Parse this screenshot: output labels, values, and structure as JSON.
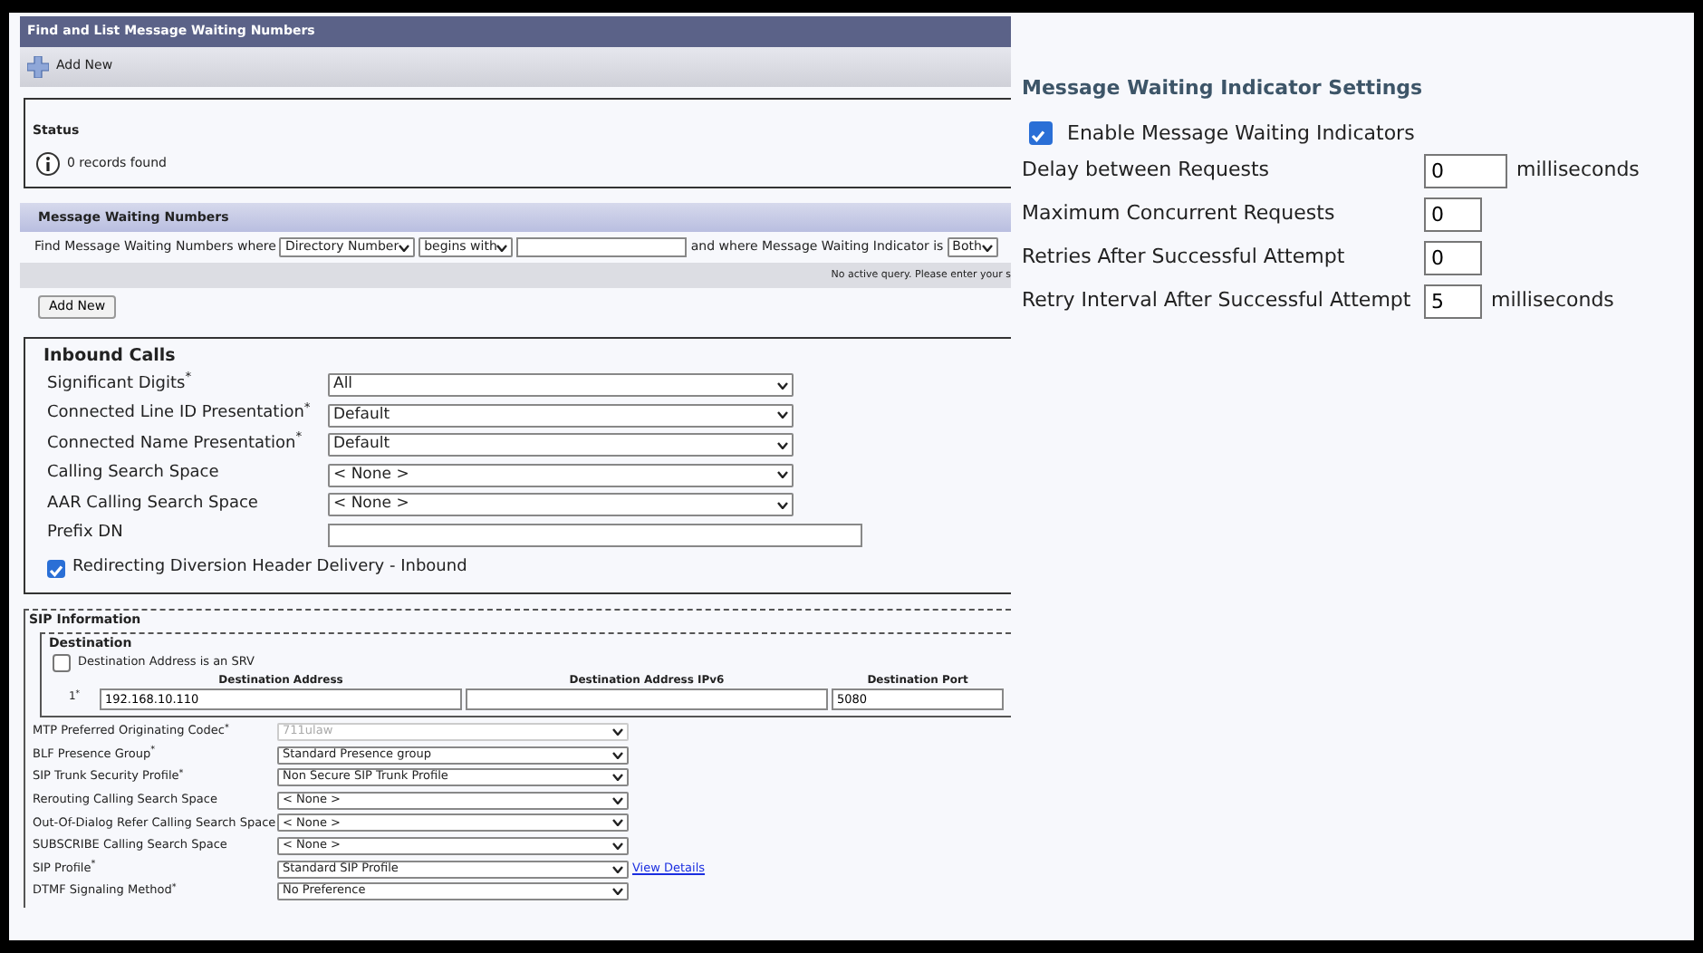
{
  "find_panel": {
    "title": "Find and List Message Waiting Numbers",
    "toolbar_button": "Add New",
    "status": {
      "legend": "Status",
      "message": "0 records found"
    },
    "section_title": "Message Waiting Numbers",
    "search": [
      {
        "kind": "label",
        "text": "Find Message Waiting Numbers where"
      },
      {
        "kind": "select",
        "value": "Directory Number"
      },
      {
        "kind": "select",
        "value": "begins with"
      },
      {
        "kind": "input"
      },
      {
        "kind": "label",
        "text": "and where Message Waiting Indicator is"
      },
      {
        "kind": "select",
        "value": "Both"
      }
    ],
    "notice": "No active query. Please enter your s",
    "button": "Add New"
  },
  "inbound_calls": {
    "legend": "Inbound Calls",
    "fields": [
      {
        "kind": "select",
        "label": "Significant Digits$^{*}$",
        "value": "All"
      },
      {
        "kind": "select",
        "label": "Connected Line ID Presentation$^{*}$",
        "value": "Default"
      },
      {
        "kind": "select",
        "label": "Connected Name Presentation$^{*}$",
        "value": "Default"
      },
      {
        "kind": "select",
        "label": "Calling Search Space",
        "value": "< None >"
      },
      {
        "kind": "select",
        "label": "AAR Calling Search Space",
        "value": "< None >"
      },
      {
        "kind": "input",
        "label": "Prefix DN"
      }
    ],
    "checkbox": {
      "label": "Redirecting Diversion Header Delivery - Inbound",
      "checked": true
    }
  },
  "sip_information": {
    "legend": "SIP Information",
    "destination": {
      "legend": "Destination",
      "checkbox": {
        "label": "Destination Address is an SRV",
        "checked": false
      },
      "columns": [
        "Destination Address",
        "Destination Address IPv6",
        "Destination Port"
      ],
      "rows": [
        {
          "index": "1$^{*}$",
          "address": "192.168.10.110",
          "port": "5080"
        }
      ]
    },
    "fields": [
      {
        "label": "MTP Preferred Originating Codec$^{*}$",
        "value": "711ulaw",
        "disabled": true
      },
      {
        "label": "BLF Presence Group$^{*}$",
        "value": "Standard Presence group",
        "disabled": false
      },
      {
        "label": "SIP Trunk Security Profile$^{*}$",
        "value": "Non Secure SIP Trunk Profile",
        "disabled": false
      },
      {
        "label": "Rerouting Calling Search Space",
        "value": "< None >",
        "disabled": false
      },
      {
        "label": "Out-Of-Dialog Refer Calling Search Space",
        "value": "< None >",
        "disabled": false
      },
      {
        "label": "SUBSCRIBE Calling Search Space",
        "value": "< None >",
        "disabled": false
      },
      {
        "label": "SIP Profile$^{*}$",
        "value": "Standard SIP Profile",
        "disabled": false,
        "link": "View Details"
      },
      {
        "label": "DTMF Signaling Method$^{*}$",
        "value": "No Preference",
        "disabled": false
      }
    ]
  },
  "mwi_settings": {
    "title": "Message Waiting Indicator Settings",
    "checkbox": {
      "label": "Enable Message Waiting Indicators",
      "checked": true
    },
    "fields": [
      {
        "label": "Delay between Requests",
        "value": "0",
        "unit": "milliseconds"
      },
      {
        "label": "Maximum Concurrent Requests",
        "value": "0"
      },
      {
        "label": "Retries After Successful Attempt",
        "value": "0"
      },
      {
        "label": "Retry Interval After Successful Attempt",
        "value": "5",
        "unit": "milliseconds"
      }
    ]
  }
}
